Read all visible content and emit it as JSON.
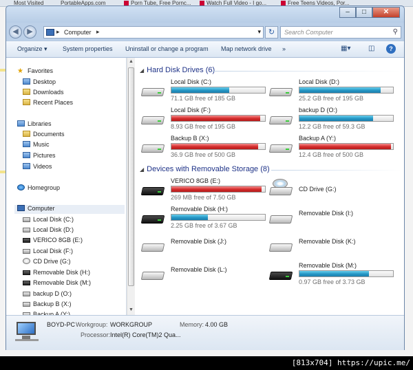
{
  "browser_tabs": [
    {
      "label": "Most Visited"
    },
    {
      "label": "PortableApps.com"
    },
    {
      "label": "Porn Tube, Free Pornc..."
    },
    {
      "label": "Watch Full Video - I go..."
    },
    {
      "label": "Free Teens Videos, Por..."
    }
  ],
  "window": {
    "minimize": "–",
    "maximize": "□",
    "close": "✕"
  },
  "address": {
    "path": "Computer",
    "search_placeholder": "Search Computer"
  },
  "toolbar": {
    "organize": "Organize ▾",
    "system_properties": "System properties",
    "uninstall": "Uninstall or change a program",
    "map_drive": "Map network drive",
    "more": "»"
  },
  "nav": {
    "favorites": "Favorites",
    "desktop": "Desktop",
    "downloads": "Downloads",
    "recent": "Recent Places",
    "libraries": "Libraries",
    "documents": "Documents",
    "music": "Music",
    "pictures": "Pictures",
    "videos": "Videos",
    "homegroup": "Homegroup",
    "computer": "Computer",
    "drives": [
      {
        "label": "Local Disk (C:)"
      },
      {
        "label": "Local Disk (D:)"
      },
      {
        "label": "VERICO 8GB (E:)"
      },
      {
        "label": "Local Disk (F:)"
      },
      {
        "label": "CD Drive (G:)"
      },
      {
        "label": "Removable Disk (H:)"
      },
      {
        "label": "Removable Disk (M:)"
      },
      {
        "label": "backup D (O:)"
      },
      {
        "label": "Backup B (X:)"
      },
      {
        "label": "Backup A (Y:)"
      }
    ]
  },
  "sections": {
    "hdd": "Hard Disk Drives (6)",
    "removable": "Devices with Removable Storage (8)"
  },
  "hdd_drives": [
    {
      "name": "Local Disk (C:)",
      "free_text": "71.1 GB free of 185 GB",
      "used_fraction": 0.62,
      "color": "#2596c4"
    },
    {
      "name": "Local Disk (D:)",
      "free_text": "25.2 GB free of 195 GB",
      "used_fraction": 0.87,
      "color": "#2596c4"
    },
    {
      "name": "Local Disk (F:)",
      "free_text": "8.93 GB free of 195 GB",
      "used_fraction": 0.95,
      "color": "#d32a2a"
    },
    {
      "name": "backup D (O:)",
      "free_text": "12.2 GB free of 59.3 GB",
      "used_fraction": 0.79,
      "color": "#2596c4"
    },
    {
      "name": "Backup B (X:)",
      "free_text": "36.9 GB free of 500 GB",
      "used_fraction": 0.93,
      "color": "#d32a2a"
    },
    {
      "name": "Backup A (Y:)",
      "free_text": "12.4 GB free of 500 GB",
      "used_fraction": 0.98,
      "color": "#d32a2a"
    }
  ],
  "removable_drives": [
    {
      "name": "VERICO 8GB (E:)",
      "free_text": "269 MB free of 7.50 GB",
      "used_fraction": 0.96,
      "color": "#d32a2a"
    },
    {
      "name": "CD Drive (G:)"
    },
    {
      "name": "Removable Disk (H:)",
      "free_text": "2.25 GB free of 3.67 GB",
      "used_fraction": 0.39,
      "color": "#2596c4"
    },
    {
      "name": "Removable Disk (I:)"
    },
    {
      "name": "Removable Disk (J:)"
    },
    {
      "name": "Removable Disk (K:)"
    },
    {
      "name": "Removable Disk (L:)"
    },
    {
      "name": "Removable Disk (M:)",
      "free_text": "0.97 GB free of 3.73 GB",
      "used_fraction": 0.74,
      "color": "#2596c4"
    }
  ],
  "details": {
    "pc_name": "BOYD-PC",
    "workgroup_label": "Workgroup:",
    "workgroup": "WORKGROUP",
    "memory_label": "Memory:",
    "memory": "4.00 GB",
    "processor_label": "Processor:",
    "processor": "Intel(R) Core(TM)2 Qua..."
  },
  "watermark": "[813x704] https://upic.me/"
}
